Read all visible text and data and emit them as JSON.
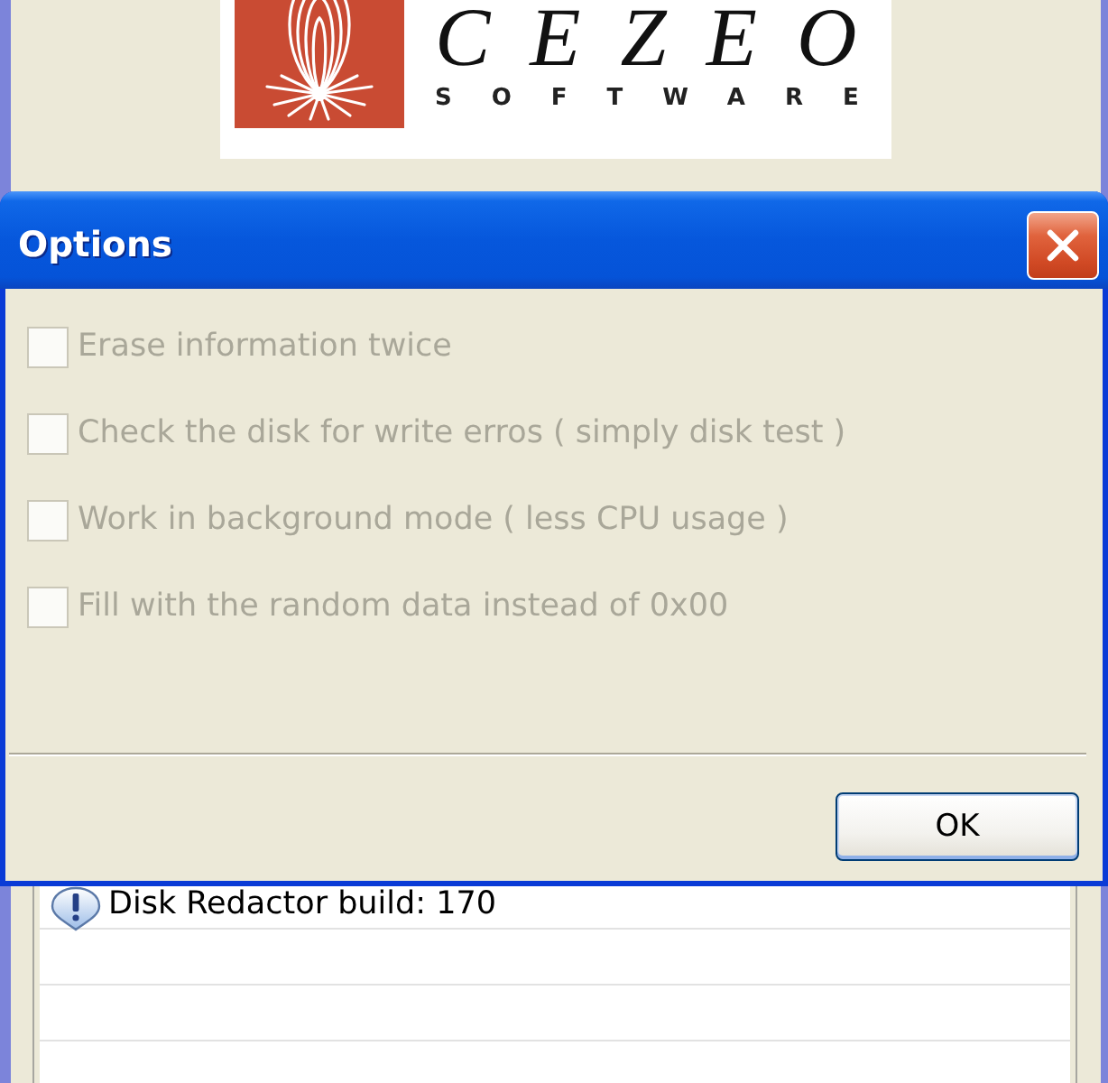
{
  "main_window": {
    "logo": {
      "wordmark": "CEZEO",
      "tagline": "SOFTWARE"
    },
    "log": {
      "rows": [
        {
          "kind": "info",
          "text": "Disk Redactor build: 170"
        }
      ]
    }
  },
  "dialog": {
    "title": "Options",
    "options": [
      {
        "label": "Erase information twice",
        "checked": false,
        "disabled": true
      },
      {
        "label": "Check the disk for write erros ( simply disk test )",
        "checked": false,
        "disabled": true
      },
      {
        "label": "Work in background mode ( less CPU usage )",
        "checked": false,
        "disabled": true
      },
      {
        "label": "Fill with the random data instead of 0x00",
        "checked": false,
        "disabled": true
      }
    ],
    "buttons": [
      {
        "label": "OK",
        "default": true
      }
    ]
  }
}
